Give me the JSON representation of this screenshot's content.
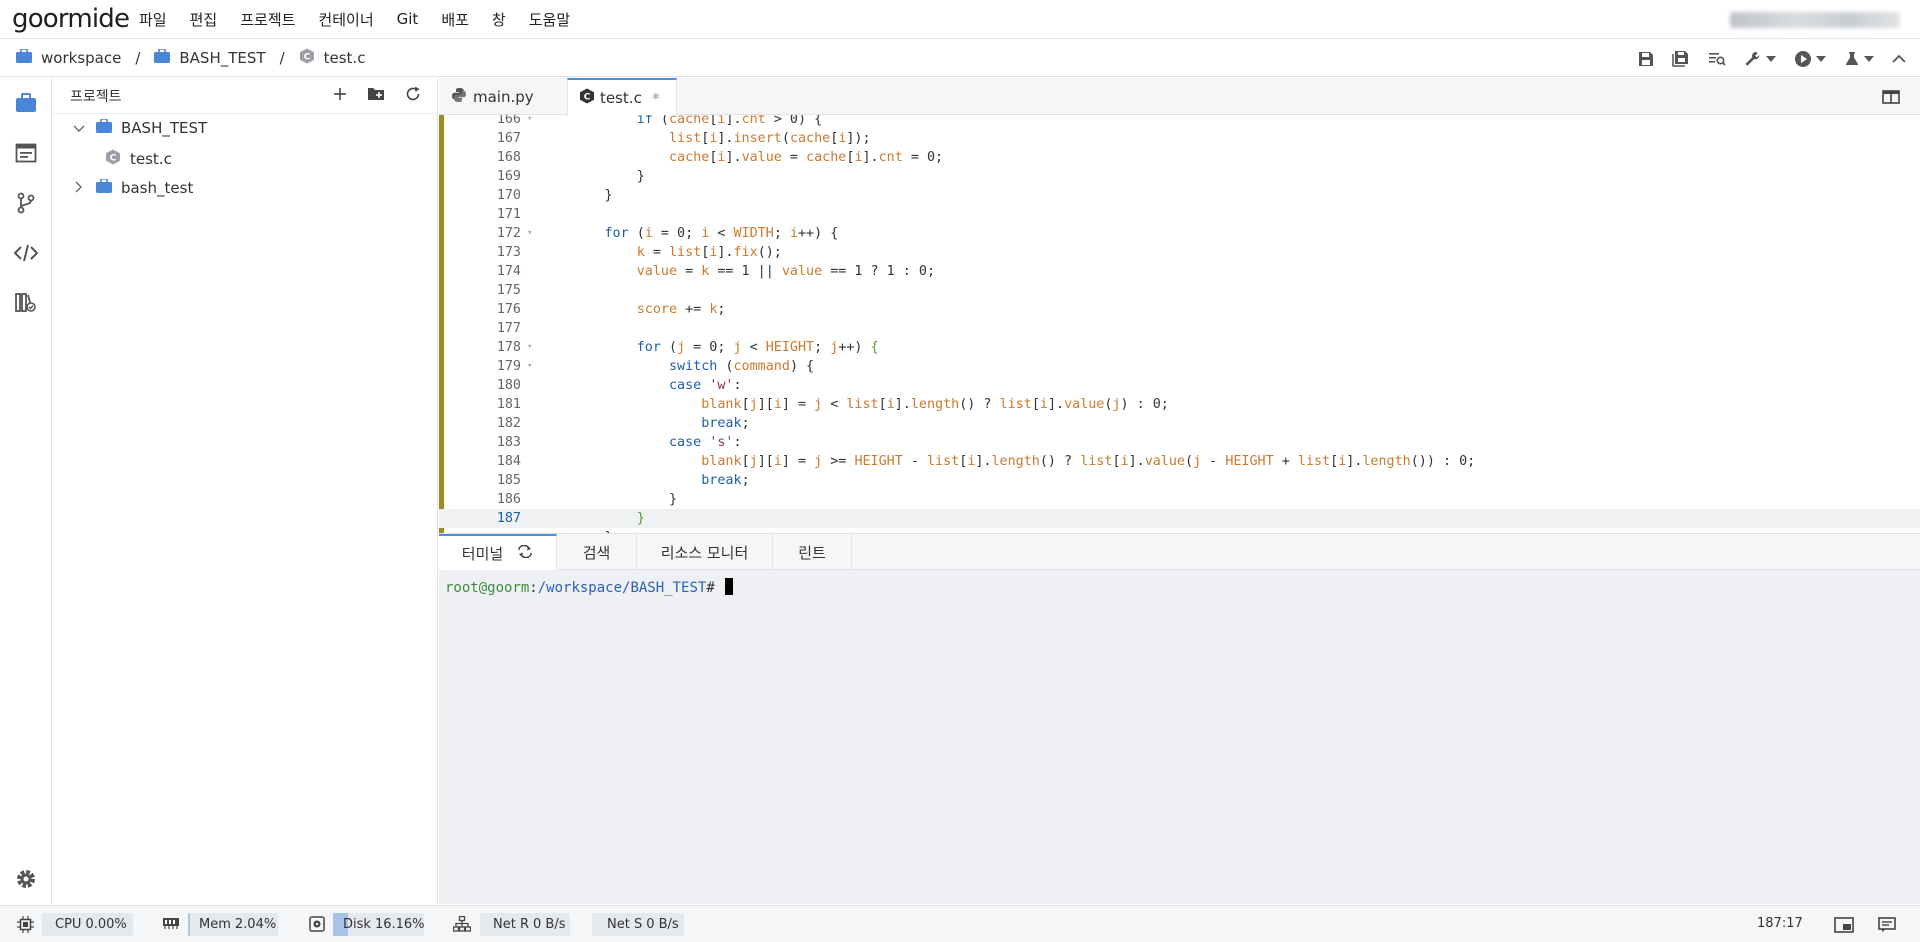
{
  "app": {
    "logo": "goormide",
    "account_blurred": true
  },
  "menu": [
    "파일",
    "편집",
    "프로젝트",
    "컨테이너",
    "Git",
    "배포",
    "창",
    "도움말"
  ],
  "breadcrumb": {
    "items": [
      "workspace",
      "BASH_TEST",
      "test.c"
    ],
    "separator": "/"
  },
  "toolbar": {
    "icons": [
      "save-icon",
      "save-all-icon",
      "search-code-icon",
      "wrench-icon",
      "run-icon",
      "test-flask-icon",
      "collapse-icon"
    ]
  },
  "activity": [
    "project-icon",
    "terminal-panel-icon",
    "git-branch-icon",
    "code-icon",
    "library-icon",
    "settings-icon"
  ],
  "project": {
    "title": "프로젝트",
    "tree": [
      {
        "label": "BASH_TEST",
        "type": "folder",
        "expanded": true
      },
      {
        "label": "test.c",
        "type": "file"
      },
      {
        "label": "bash_test",
        "type": "folder",
        "expanded": false
      }
    ]
  },
  "editor": {
    "tabs": [
      {
        "label": "main.py",
        "icon": "python-icon",
        "active": false
      },
      {
        "label": "test.c",
        "icon": "c-file-icon",
        "active": true,
        "modified_mark": "*"
      }
    ],
    "current_line": 187
  },
  "panel": {
    "tabs": [
      "터미널",
      "검색",
      "리소스 모니터",
      "린트"
    ],
    "terminal": {
      "user": "root@goorm",
      "sep": ":",
      "path": "/workspace/BASH_TEST",
      "prompt": "#"
    }
  },
  "status": {
    "cpu": {
      "label": "CPU",
      "value": "0.00%",
      "fraction": 0.0
    },
    "mem": {
      "label": "Mem",
      "value": "2.04%",
      "fraction": 0.0204
    },
    "disk": {
      "label": "Disk",
      "value": "16.16%",
      "fraction": 0.1616
    },
    "net_r": {
      "label": "Net R",
      "value": "0 B/s"
    },
    "net_s": {
      "label": "Net S",
      "value": "0 B/s"
    },
    "cursor_pos": "187:17"
  },
  "colors": {
    "accent": "#4a90e2",
    "folder_blue": "#4a86d8",
    "modified_gutter": "#9a8c1e"
  }
}
